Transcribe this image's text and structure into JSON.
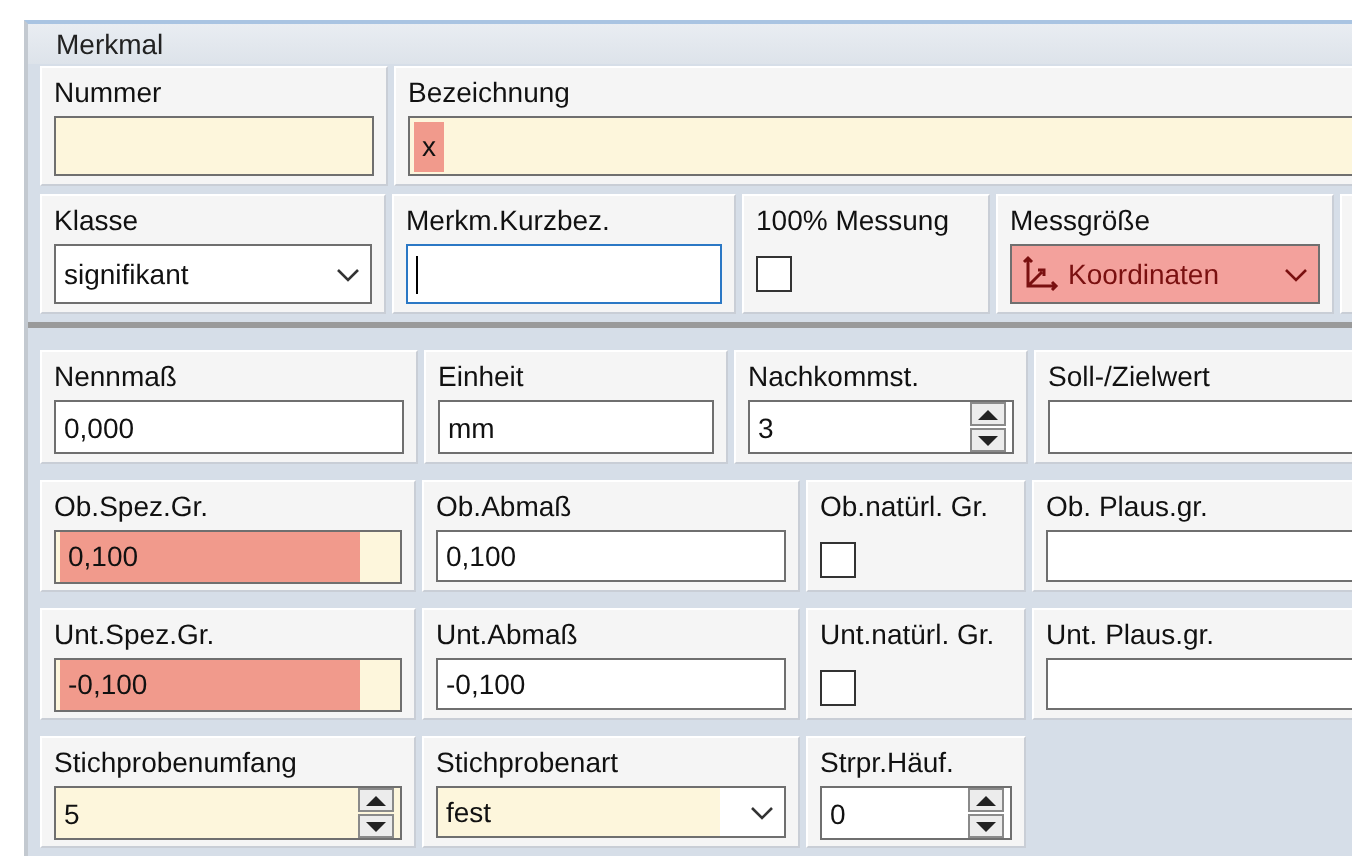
{
  "group": {
    "title": "Merkmal"
  },
  "sections": [
    {
      "rows": [
        {
          "cells": [
            {
              "kind": "text",
              "label": "Nummer",
              "required": true,
              "invalid": false,
              "focused": false
            },
            {
              "kind": "text",
              "label": "Bezeichnung",
              "required": true,
              "invalid": true,
              "value": "x",
              "focused": false
            }
          ]
        },
        {
          "cells": [
            {
              "kind": "combo",
              "label": "Klasse",
              "required": false,
              "invalid": false,
              "value": "signifikant"
            },
            {
              "kind": "text",
              "label": "Merkm.Kurzbez.",
              "required": false,
              "invalid": false,
              "focused": true
            },
            {
              "kind": "check",
              "label": "100% Messung",
              "checked": false
            },
            {
              "kind": "icon-combo",
              "label": "Messgröße",
              "required": false,
              "invalid": true,
              "value": "Koordinaten"
            },
            {
              "kind": "blank"
            }
          ]
        }
      ]
    },
    {
      "rows": [
        {
          "cells": [
            {
              "kind": "text",
              "label": "Nennmaß",
              "required": false,
              "invalid": false,
              "value": "0,000",
              "focused": false
            },
            {
              "kind": "text",
              "label": "Einheit",
              "required": false,
              "invalid": false,
              "value": "mm",
              "focused": false
            },
            {
              "kind": "spin",
              "label": "Nachkommst.",
              "required": false,
              "invalid": false,
              "value": "3"
            },
            {
              "kind": "text",
              "label": "Soll-/Zielwert",
              "required": false,
              "invalid": false,
              "focused": false
            }
          ]
        },
        {
          "cells": [
            {
              "kind": "text",
              "label": "Ob.Spez.Gr.",
              "required": true,
              "invalid": true,
              "value": "0,100",
              "focused": false
            },
            {
              "kind": "text",
              "label": "Ob.Abmaß",
              "required": false,
              "invalid": false,
              "value": "0,100",
              "focused": false
            },
            {
              "kind": "check",
              "label": "Ob.natürl. Gr.",
              "checked": false
            },
            {
              "kind": "text",
              "label": "Ob. Plaus.gr.",
              "required": false,
              "invalid": false,
              "focused": false
            }
          ]
        },
        {
          "cells": [
            {
              "kind": "text",
              "label": "Unt.Spez.Gr.",
              "required": true,
              "invalid": true,
              "value": "-0,100",
              "focused": false
            },
            {
              "kind": "text",
              "label": "Unt.Abmaß",
              "required": false,
              "invalid": false,
              "value": "-0,100",
              "focused": false
            },
            {
              "kind": "check",
              "label": "Unt.natürl. Gr.",
              "checked": false
            },
            {
              "kind": "text",
              "label": "Unt. Plaus.gr.",
              "required": false,
              "invalid": false,
              "focused": false
            }
          ]
        },
        {
          "cells": [
            {
              "kind": "spin",
              "label": "Stichprobenumfang",
              "required": true,
              "invalid": false,
              "value": "5"
            },
            {
              "kind": "combo",
              "label": "Stichprobenart",
              "required": true,
              "invalid": false,
              "value": "fest"
            },
            {
              "kind": "spin",
              "label": "Strpr.Häuf.",
              "required": false,
              "invalid": false,
              "value": "0"
            }
          ]
        }
      ]
    }
  ]
}
